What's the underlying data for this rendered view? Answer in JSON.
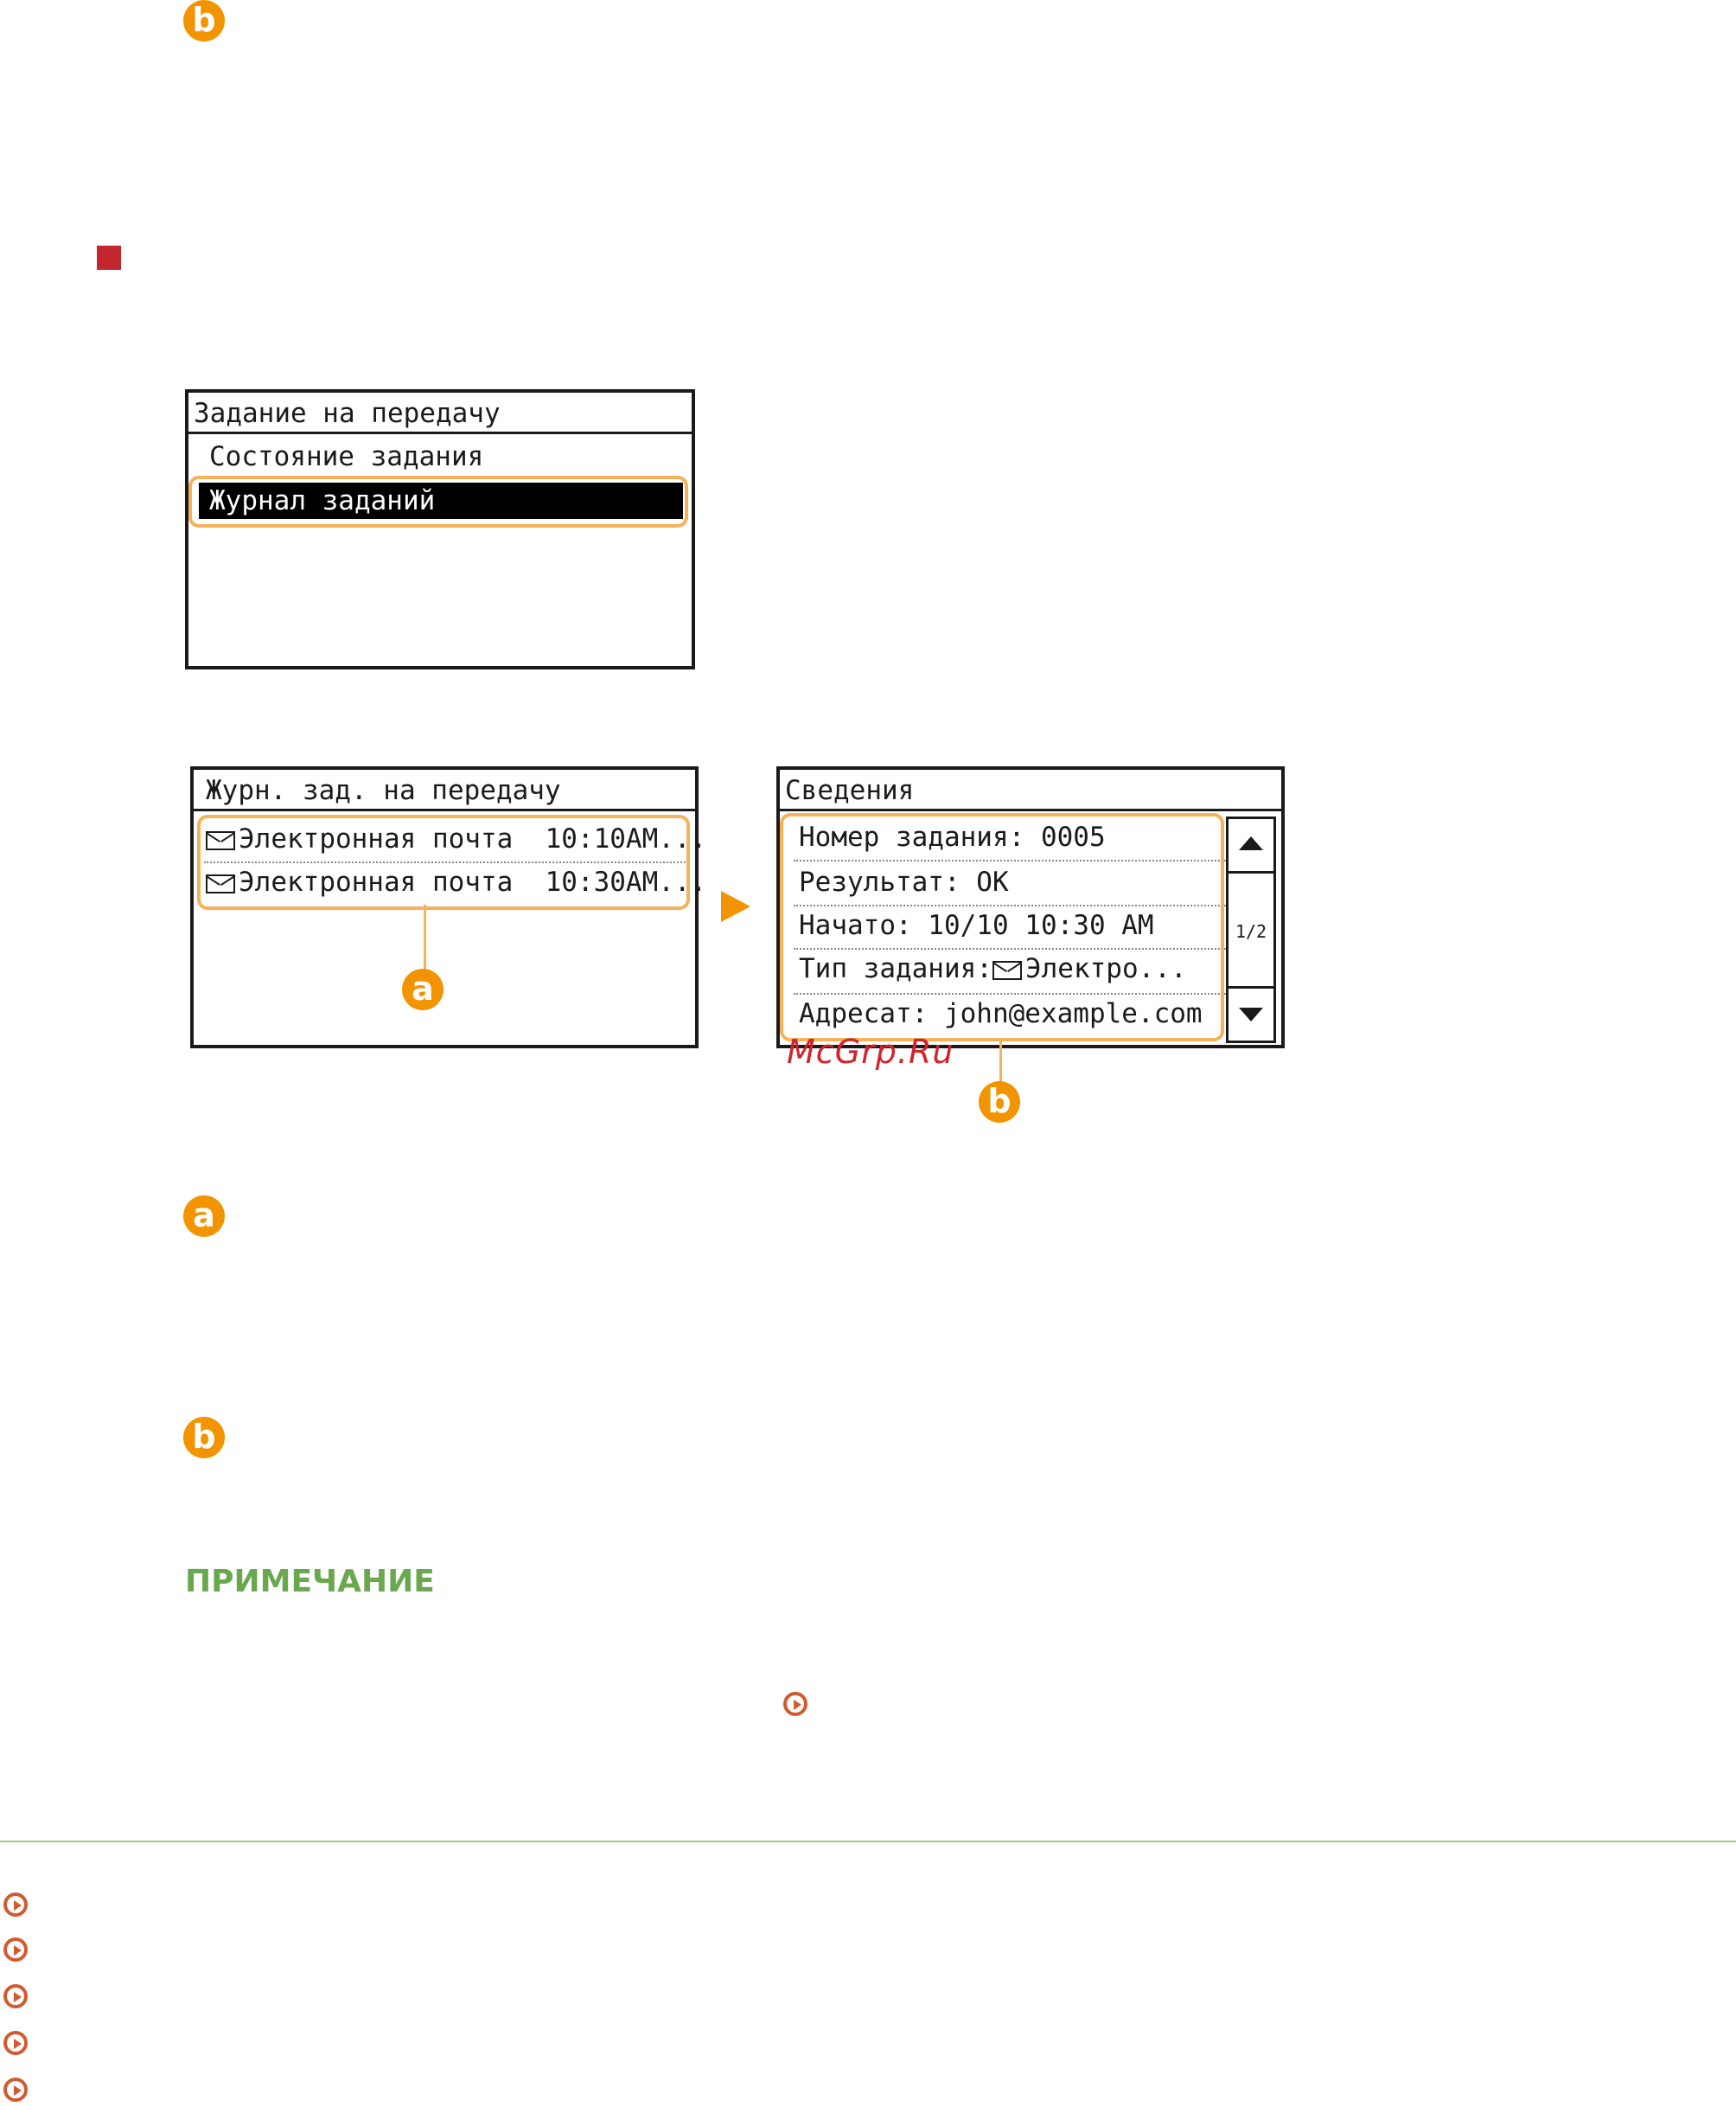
{
  "callouts": {
    "a": "a",
    "b": "b"
  },
  "screen1": {
    "title": "Задание на передачу",
    "items": [
      "Состояние задания",
      "Журнал заданий"
    ]
  },
  "screen2": {
    "title": "Журн. зад. на передачу",
    "rows": [
      {
        "type": "Электронная почта",
        "time": "10:10AM..."
      },
      {
        "type": "Электронная почта",
        "time": "10:30AM..."
      }
    ]
  },
  "screen3": {
    "title": "Сведения",
    "rows": [
      "Номер задания: 0005",
      "Результат: OK",
      "Начато: 10/10 10:30 AM",
      "Тип задания:",
      "Адресат: john@example.com"
    ],
    "job_type_value": "Электро...",
    "page_indicator": "1/2"
  },
  "note_heading": "ПРИМЕЧАНИЕ",
  "watermark": "McGrp.Ru",
  "colors": {
    "accent": "#f29400",
    "red": "#c1272d",
    "note_green": "#6aa84f",
    "link": "#d25a30"
  },
  "icons": [
    "envelope-icon",
    "scroll-up-icon",
    "scroll-down-icon",
    "next-arrow-icon",
    "link-arrow-icon"
  ]
}
